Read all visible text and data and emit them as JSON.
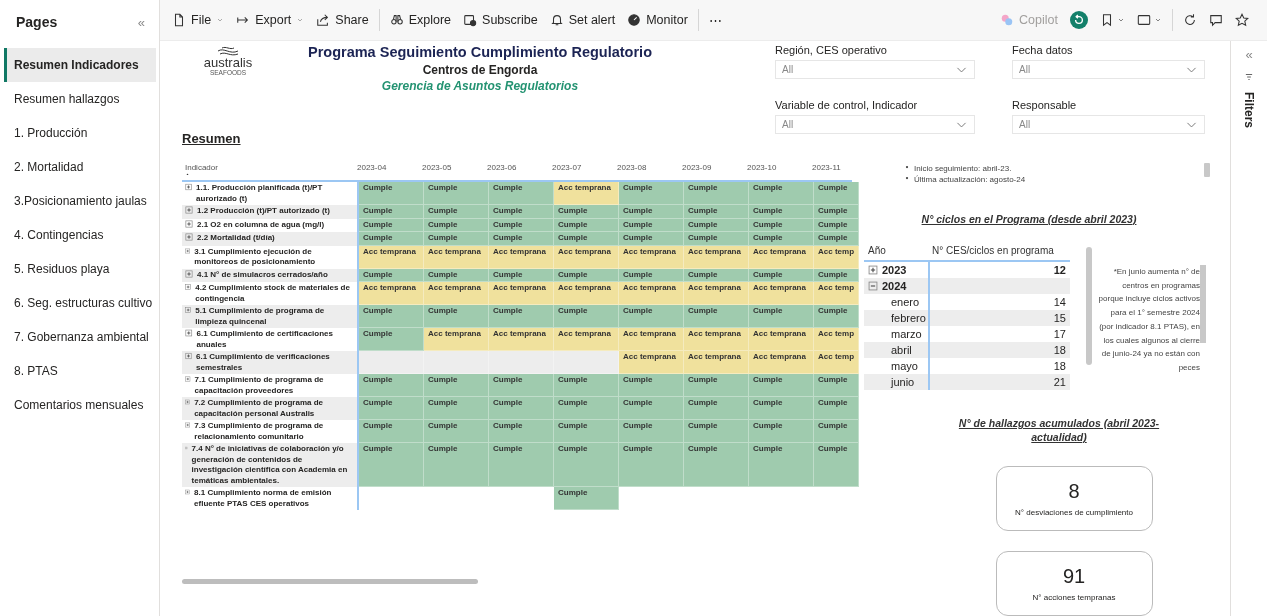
{
  "pages": {
    "title": "Pages",
    "collapse": "«",
    "items": [
      {
        "label": "Resumen Indicadores",
        "selected": true
      },
      {
        "label": "Resumen hallazgos",
        "selected": false
      },
      {
        "label": "1. Producción",
        "selected": false
      },
      {
        "label": "2. Mortalidad",
        "selected": false
      },
      {
        "label": "3.Posicionamiento jaulas",
        "selected": false
      },
      {
        "label": "4. Contingencias",
        "selected": false
      },
      {
        "label": "5. Residuos playa",
        "selected": false
      },
      {
        "label": "6. Seg. estructuras cultivo",
        "selected": false
      },
      {
        "label": "7. Gobernanza ambiental",
        "selected": false
      },
      {
        "label": "8. PTAS",
        "selected": false
      },
      {
        "label": "Comentarios mensuales",
        "selected": false
      }
    ]
  },
  "toolbar": {
    "left": [
      {
        "label": "File",
        "has_menu": true
      },
      {
        "label": "Export",
        "has_menu": true
      },
      {
        "label": "Share"
      },
      {
        "label": "Explore"
      },
      {
        "label": "Subscribe"
      },
      {
        "label": "Set alert"
      },
      {
        "label": "Monitor"
      }
    ],
    "more": "⋯",
    "copilot": {
      "label": "Copilot",
      "disabled": true
    }
  },
  "filters_pane": {
    "collapse": "«",
    "label": "Filters"
  },
  "report": {
    "logo": {
      "name": "australis",
      "tagline": "SEAFOODS"
    },
    "title": "Programa Seguimiento Cumplimiento Regulatorio",
    "subtitle": "Centros de Engorda",
    "department": "Gerencia de Asuntos Regulatorios",
    "section": "Resumen",
    "slicers": [
      {
        "label": "Región, CES operativo",
        "value": "All"
      },
      {
        "label": "Fecha datos",
        "value": "All"
      },
      {
        "label": "Variable de control, Indicador",
        "value": "All"
      },
      {
        "label": "Responsable",
        "value": "All"
      }
    ],
    "matrix": {
      "row_header": "Indicador",
      "columns": [
        "2023-04",
        "2023-05",
        "2023-06",
        "2023-07",
        "2023-08",
        "2023-09",
        "2023-10",
        "2023-11"
      ],
      "rows": [
        {
          "label": "1.1. Producción planificada (t)/PT aurorizado (t)",
          "cells": [
            {
              "kind": "cumple",
              "text": "Cumple"
            },
            {
              "kind": "cumple",
              "text": "Cumple"
            },
            {
              "kind": "cumple",
              "text": "Cumple"
            },
            {
              "kind": "acc",
              "text": "Acc temprana"
            },
            {
              "kind": "cumple",
              "text": "Cumple"
            },
            {
              "kind": "cumple",
              "text": "Cumple"
            },
            {
              "kind": "cumple",
              "text": "Cumple"
            },
            {
              "kind": "cumple",
              "text": "Cumple"
            }
          ]
        },
        {
          "label": "1.2 Producción (t)/PT autorizado (t)",
          "cells": [
            {
              "kind": "cumple",
              "text": "Cumple"
            },
            {
              "kind": "cumple",
              "text": "Cumple"
            },
            {
              "kind": "cumple",
              "text": "Cumple"
            },
            {
              "kind": "cumple",
              "text": "Cumple"
            },
            {
              "kind": "cumple",
              "text": "Cumple"
            },
            {
              "kind": "cumple",
              "text": "Cumple"
            },
            {
              "kind": "cumple",
              "text": "Cumple"
            },
            {
              "kind": "cumple",
              "text": "Cumple"
            }
          ]
        },
        {
          "label": "2.1 O2 en columna de agua (mg/l)",
          "cells": [
            {
              "kind": "cumple",
              "text": "Cumple"
            },
            {
              "kind": "cumple",
              "text": "Cumple"
            },
            {
              "kind": "cumple",
              "text": "Cumple"
            },
            {
              "kind": "cumple",
              "text": "Cumple"
            },
            {
              "kind": "cumple",
              "text": "Cumple"
            },
            {
              "kind": "cumple",
              "text": "Cumple"
            },
            {
              "kind": "cumple",
              "text": "Cumple"
            },
            {
              "kind": "cumple",
              "text": "Cumple"
            }
          ]
        },
        {
          "label": "2.2 Mortalidad (t/día)",
          "cells": [
            {
              "kind": "cumple",
              "text": "Cumple"
            },
            {
              "kind": "cumple",
              "text": "Cumple"
            },
            {
              "kind": "cumple",
              "text": "Cumple"
            },
            {
              "kind": "cumple",
              "text": "Cumple"
            },
            {
              "kind": "cumple",
              "text": "Cumple"
            },
            {
              "kind": "cumple",
              "text": "Cumple"
            },
            {
              "kind": "cumple",
              "text": "Cumple"
            },
            {
              "kind": "cumple",
              "text": "Cumple"
            }
          ]
        },
        {
          "label": "3.1 Cumplimiento ejecución de monitoreos de posicionamiento",
          "cells": [
            {
              "kind": "acc",
              "text": "Acc temprana"
            },
            {
              "kind": "acc",
              "text": "Acc temprana"
            },
            {
              "kind": "acc",
              "text": "Acc temprana"
            },
            {
              "kind": "acc",
              "text": "Acc temprana"
            },
            {
              "kind": "acc",
              "text": "Acc temprana"
            },
            {
              "kind": "acc",
              "text": "Acc temprana"
            },
            {
              "kind": "acc",
              "text": "Acc temprana"
            },
            {
              "kind": "acc",
              "text": "Acc temp"
            }
          ]
        },
        {
          "label": "4.1 N° de simulacros cerrados/año",
          "cells": [
            {
              "kind": "cumple",
              "text": "Cumple"
            },
            {
              "kind": "cumple",
              "text": "Cumple"
            },
            {
              "kind": "cumple",
              "text": "Cumple"
            },
            {
              "kind": "cumple",
              "text": "Cumple"
            },
            {
              "kind": "cumple",
              "text": "Cumple"
            },
            {
              "kind": "cumple",
              "text": "Cumple"
            },
            {
              "kind": "cumple",
              "text": "Cumple"
            },
            {
              "kind": "cumple",
              "text": "Cumple"
            }
          ]
        },
        {
          "label": "4.2 Cumplimiento stock de materiales de contingencia",
          "cells": [
            {
              "kind": "acc",
              "text": "Acc temprana"
            },
            {
              "kind": "acc",
              "text": "Acc temprana"
            },
            {
              "kind": "acc",
              "text": "Acc temprana"
            },
            {
              "kind": "acc",
              "text": "Acc temprana"
            },
            {
              "kind": "acc",
              "text": "Acc temprana"
            },
            {
              "kind": "acc",
              "text": "Acc temprana"
            },
            {
              "kind": "acc",
              "text": "Acc temprana"
            },
            {
              "kind": "acc",
              "text": "Acc temp"
            }
          ]
        },
        {
          "label": "5.1 Cumplimiento de programa de limpieza quincenal",
          "cells": [
            {
              "kind": "cumple",
              "text": "Cumple"
            },
            {
              "kind": "cumple",
              "text": "Cumple"
            },
            {
              "kind": "cumple",
              "text": "Cumple"
            },
            {
              "kind": "cumple",
              "text": "Cumple"
            },
            {
              "kind": "cumple",
              "text": "Cumple"
            },
            {
              "kind": "cumple",
              "text": "Cumple"
            },
            {
              "kind": "cumple",
              "text": "Cumple"
            },
            {
              "kind": "cumple",
              "text": "Cumple"
            }
          ]
        },
        {
          "label": "6.1 Cumplimiento de certificaciones anuales",
          "cells": [
            {
              "kind": "cumple",
              "text": "Cumple"
            },
            {
              "kind": "acc",
              "text": "Acc temprana"
            },
            {
              "kind": "acc",
              "text": "Acc temprana"
            },
            {
              "kind": "acc",
              "text": "Acc temprana"
            },
            {
              "kind": "acc",
              "text": "Acc temprana"
            },
            {
              "kind": "acc",
              "text": "Acc temprana"
            },
            {
              "kind": "acc",
              "text": "Acc temprana"
            },
            {
              "kind": "acc",
              "text": "Acc temp"
            }
          ]
        },
        {
          "label": "6.1 Cumplimiento de verificaciones semestrales",
          "cells": [
            {
              "kind": "empty"
            },
            {
              "kind": "empty"
            },
            {
              "kind": "empty"
            },
            {
              "kind": "empty"
            },
            {
              "kind": "acc",
              "text": "Acc temprana"
            },
            {
              "kind": "acc",
              "text": "Acc temprana"
            },
            {
              "kind": "acc",
              "text": "Acc temprana"
            },
            {
              "kind": "acc",
              "text": "Acc temp"
            }
          ]
        },
        {
          "label": "7.1 Cumplimiento de programa de capacitación proveedores",
          "cells": [
            {
              "kind": "cumple",
              "text": "Cumple"
            },
            {
              "kind": "cumple",
              "text": "Cumple"
            },
            {
              "kind": "cumple",
              "text": "Cumple"
            },
            {
              "kind": "cumple",
              "text": "Cumple"
            },
            {
              "kind": "cumple",
              "text": "Cumple"
            },
            {
              "kind": "cumple",
              "text": "Cumple"
            },
            {
              "kind": "cumple",
              "text": "Cumple"
            },
            {
              "kind": "cumple",
              "text": "Cumple"
            }
          ]
        },
        {
          "label": "7.2 Cumplimiento de programa de capacitación personal Australis",
          "cells": [
            {
              "kind": "cumple",
              "text": "Cumple"
            },
            {
              "kind": "cumple",
              "text": "Cumple"
            },
            {
              "kind": "cumple",
              "text": "Cumple"
            },
            {
              "kind": "cumple",
              "text": "Cumple"
            },
            {
              "kind": "cumple",
              "text": "Cumple"
            },
            {
              "kind": "cumple",
              "text": "Cumple"
            },
            {
              "kind": "cumple",
              "text": "Cumple"
            },
            {
              "kind": "cumple",
              "text": "Cumple"
            }
          ]
        },
        {
          "label": "7.3 Cumplimiento de programa de relacionamiento comunitario",
          "cells": [
            {
              "kind": "cumple",
              "text": "Cumple"
            },
            {
              "kind": "cumple",
              "text": "Cumple"
            },
            {
              "kind": "cumple",
              "text": "Cumple"
            },
            {
              "kind": "cumple",
              "text": "Cumple"
            },
            {
              "kind": "cumple",
              "text": "Cumple"
            },
            {
              "kind": "cumple",
              "text": "Cumple"
            },
            {
              "kind": "cumple",
              "text": "Cumple"
            },
            {
              "kind": "cumple",
              "text": "Cumple"
            }
          ]
        },
        {
          "label": "7.4 N° de iniciativas de colaboración y/o generación de contenidos de investigación científica con Academia en temáticas ambientales.",
          "cells": [
            {
              "kind": "cumple",
              "text": "Cumple"
            },
            {
              "kind": "cumple",
              "text": "Cumple"
            },
            {
              "kind": "cumple",
              "text": "Cumple"
            },
            {
              "kind": "cumple",
              "text": "Cumple"
            },
            {
              "kind": "cumple",
              "text": "Cumple"
            },
            {
              "kind": "cumple",
              "text": "Cumple"
            },
            {
              "kind": "cumple",
              "text": "Cumple"
            },
            {
              "kind": "cumple",
              "text": "Cumple"
            }
          ]
        },
        {
          "label": "8.1 Cumplimiento norma de emisión efluente PTAS CES operativos",
          "cells": [
            {
              "kind": "empty"
            },
            {
              "kind": "empty"
            },
            {
              "kind": "empty"
            },
            {
              "kind": "cumple",
              "text": "Cumple"
            },
            {
              "kind": "empty"
            },
            {
              "kind": "empty"
            },
            {
              "kind": "empty"
            },
            {
              "kind": "empty"
            }
          ]
        }
      ]
    },
    "notes": [
      "Inicio seguimiento: abril-23.",
      "Última actualización: agosto-24"
    ],
    "cycles_title": "N° ciclos en el Programa (desde abril 2023)",
    "cycles_table": {
      "columns": [
        "Año",
        "N° CES/ciclos en programa"
      ],
      "rows": [
        {
          "label": "2023",
          "value": "12",
          "expanded": false
        },
        {
          "label": "2024",
          "expanded": true,
          "children": [
            {
              "label": "enero",
              "value": "14"
            },
            {
              "label": "febrero",
              "value": "15"
            },
            {
              "label": "marzo",
              "value": "17"
            },
            {
              "label": "abril",
              "value": "18"
            },
            {
              "label": "mayo",
              "value": "18"
            },
            {
              "label": "junio",
              "value": "21"
            }
          ]
        }
      ]
    },
    "cycles_note": "*En junio aumenta n°  de centros en programas porque incluye ciclos activos para el 1° semestre 2024 (por indicador 8.1 PTAS), en los cuales algunos al cierre de junio-24 ya no están con peces",
    "findings_title": "N° de hallazgos acumulados (abril 2023-actualidad)",
    "cards": [
      {
        "value": "8",
        "label": "N° desviaciones de cumplimiento"
      },
      {
        "value": "91",
        "label": "N° acciones tempranas"
      }
    ]
  }
}
